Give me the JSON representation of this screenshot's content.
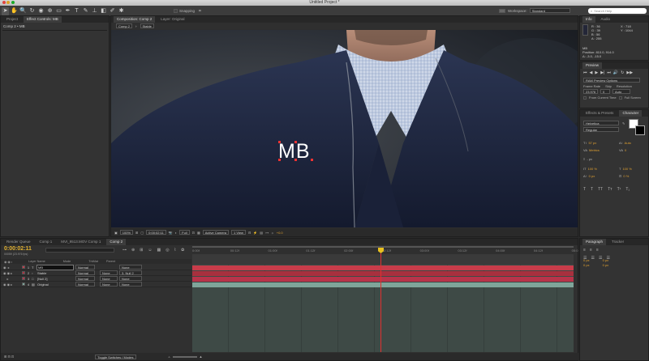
{
  "window": {
    "title": "Untitled Project *"
  },
  "toolbar": {
    "snapping_label": "Snapping",
    "workspace_label": "Workspace:",
    "workspace_value": "Standard",
    "search_placeholder": "Search Help"
  },
  "left_panel": {
    "tabs": [
      "Project",
      "Effect Controls: MB"
    ],
    "breadcrumb": "Comp 2 • MB"
  },
  "composition": {
    "tabs": [
      "Composition: Comp 2",
      "Layer: Original"
    ],
    "sub_tabs": [
      "Comp 2",
      "Stable"
    ],
    "text_overlay": "MB",
    "footer": {
      "zoom": "100%",
      "timecode": "0:00:02:11",
      "resolution": "Full",
      "camera": "Active Camera",
      "view": "1 View",
      "exposure": "+0.0"
    }
  },
  "info_panel": {
    "tabs": [
      "Info",
      "Audio"
    ],
    "r": "R : 36",
    "g": "G : 39",
    "b": "B : 56",
    "a": "A : 255",
    "x": "X : 718",
    "y": "Y : 1044",
    "layer_name": "MB",
    "position": "Position: 810.0, 914.0",
    "delta": "Δ: -3.0, -15.0"
  },
  "preview_panel": {
    "title": "Preview",
    "ram_options": "RAM Preview Options",
    "frame_rate_label": "Frame Rate",
    "skip_label": "Skip",
    "resolution_label": "Resolution",
    "frame_rate_value": "23.976",
    "skip_value": "0",
    "resolution_value": "Auto",
    "from_current_label": "From Current Time",
    "full_screen_label": "Full Screen"
  },
  "character_panel": {
    "tabs": [
      "Effects & Presets",
      "Character"
    ],
    "font": "Helvetica",
    "style": "Regular",
    "size": "57 px",
    "leading": "Auto",
    "kerning": "Metrics",
    "tracking": "0",
    "stroke": "- px",
    "vscale": "100 %",
    "hscale": "100 %",
    "baseline": "0 px",
    "tsume": "0 %",
    "fill_color": "#ffffff",
    "stroke_color": "#000000"
  },
  "paragraph_panel": {
    "tabs": [
      "Paragraph",
      "Tracker"
    ],
    "indent_left": "0 px",
    "indent_right": "0 px",
    "space_before": "0 px",
    "space_after": "0 px"
  },
  "timeline": {
    "tabs": [
      "Render Queue",
      "Comp 1",
      "MVI_9513.MOV Comp 1",
      "Comp 2"
    ],
    "timecode": "0:00:02:11",
    "frame_info": "00059 (23.976 fps)",
    "columns": {
      "layer_name": "Layer Name",
      "mode": "Mode",
      "trkmat": "TrkMat",
      "parent": "Parent"
    },
    "layers": [
      {
        "num": "1",
        "name": "MB",
        "mode": "Normal",
        "trkmat": "",
        "parent": "None",
        "color": "#c83c4a"
      },
      {
        "num": "2",
        "name": "Stable",
        "mode": "Normal",
        "trkmat": "None",
        "parent": "3. Null 2",
        "color": "#b03040"
      },
      {
        "num": "3",
        "name": "[Null 2]",
        "mode": "Normal",
        "trkmat": "None",
        "parent": "None",
        "color": "#b8344a"
      },
      {
        "num": "4",
        "name": "Original",
        "mode": "Normal",
        "trkmat": "None",
        "parent": "None",
        "color": "#7fa59a"
      }
    ],
    "ruler": [
      "0:00f",
      "00:12f",
      "01:00f",
      "01:12f",
      "02:00f",
      "02:12f",
      "03:00f",
      "03:12f",
      "04:00f",
      "04:12f",
      "05:0"
    ],
    "toggle_label": "Toggle Switches / Modes"
  }
}
